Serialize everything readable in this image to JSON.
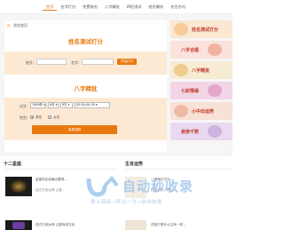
{
  "nav": {
    "items": [
      "首页",
      "名字打分",
      "免费取名",
      "八字精批",
      "四柱测试",
      "姓名解析",
      "名言名句"
    ],
    "active_index": 0
  },
  "breadcrumb": {
    "text": "测名首页"
  },
  "name_test": {
    "title": "姓名测试打分",
    "surname_label": "姓氏：",
    "given_label": "名字：",
    "button_label": "开始打分"
  },
  "bazi": {
    "title": "八字精批",
    "birth_label": "出生：",
    "year_value": "1989年",
    "month_value": "6月",
    "day_value": "9日",
    "hour_value": "00:00-00:59",
    "gender_label": "性别：",
    "male_label": "男性",
    "female_label": "女性",
    "submit_label": "免费测算"
  },
  "side_tiles": [
    {
      "label": "姓名测试打分",
      "bg": "#fbe8d2"
    },
    {
      "label": "八字合婚",
      "bg": "#fce2dc"
    },
    {
      "label": "八字精批",
      "bg": "#f6ecd3"
    },
    {
      "label": "七彩情缘",
      "bg": "#f3d6e6"
    },
    {
      "label": "小中出运势",
      "bg": "#f8e1d6"
    },
    {
      "label": "姿姿千数",
      "bg": "#ead9f0"
    }
  ],
  "bottom": {
    "left_title": "十二星座",
    "right_title": "生肖运势",
    "left_items": [
      "金星的北纬最近看现...",
      "西方古老女神 占星...",
      "西方古老女神 占星传统文化"
    ],
    "right_items": [
      "一盏来灯古为...",
      "在屋里的人同生...",
      "花瓶于是什么生肖一样..."
    ]
  },
  "watermark": {
    "title": "自动秒收录",
    "subtitle": "数上链接→来访一次→自动收录"
  },
  "colors": {
    "accent": "#e8790f",
    "panel_bg": "#fde9d3"
  }
}
